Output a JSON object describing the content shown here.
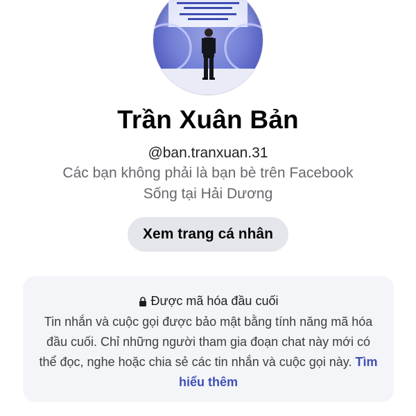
{
  "profile": {
    "name": "Trần Xuân Bản",
    "username": "@ban.tranxuan.31",
    "relation": "Các bạn không phải là bạn bè trên Facebook",
    "location": "Sống tại Hải Dương",
    "view_profile_label": "Xem trang cá nhân"
  },
  "encryption": {
    "title": "Được mã hóa đầu cuối",
    "body": "Tin nhắn và cuộc gọi được bảo mật bằng tính năng mã hóa đầu cuối. Chỉ những người tham gia đoạn chat này mới có thể đọc, nghe hoặc chia sẻ các tin nhắn và cuộc gọi này.",
    "learn_more_label": "Tìm hiểu thêm",
    "icon": "lock-icon"
  },
  "colors": {
    "link": "#3f4fb5",
    "button_bg": "#e4e6eb",
    "card_bg": "#f4f5f8",
    "secondary_text": "#65676b"
  }
}
